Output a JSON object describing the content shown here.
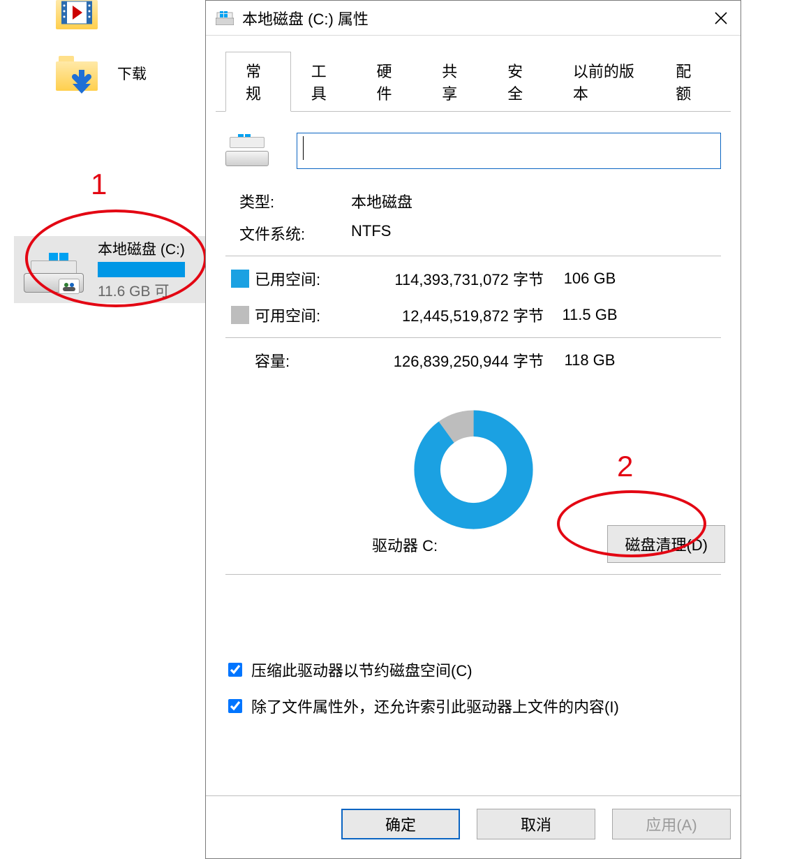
{
  "explorer": {
    "folder_downloads_label": "下载",
    "drive_c": {
      "title": "本地磁盘 (C:)",
      "subtitle": "11.6 GB 可"
    }
  },
  "window": {
    "title": "本地磁盘 (C:) 属性",
    "tabs": {
      "general": "常规",
      "tools": "工具",
      "hardware": "硬件",
      "sharing": "共享",
      "security": "安全",
      "previous": "以前的版本",
      "quota": "配额"
    },
    "name_value": "",
    "type_label": "类型:",
    "type_value": "本地磁盘",
    "fs_label": "文件系统:",
    "fs_value": "NTFS",
    "used_label": "已用空间:",
    "used_bytes": "114,393,731,072 字节",
    "used_human": "106 GB",
    "free_label": "可用空间:",
    "free_bytes": "12,445,519,872 字节",
    "free_human": "11.5 GB",
    "cap_label": "容量:",
    "cap_bytes": "126,839,250,944 字节",
    "cap_human": "118 GB",
    "drive_letter": "驱动器 C:",
    "cleanup_btn": "磁盘清理(D)",
    "check_compress": "压缩此驱动器以节约磁盘空间(C)",
    "check_index": "除了文件属性外，还允许索引此驱动器上文件的内容(I)",
    "ok": "确定",
    "cancel": "取消",
    "apply": "应用(A)"
  },
  "annotations": {
    "num1": "1",
    "num2": "2"
  },
  "chart_data": {
    "type": "pie",
    "title": "驱动器 C:",
    "categories": [
      "已用空间",
      "可用空间"
    ],
    "values": [
      106,
      11.5
    ],
    "unit": "GB",
    "colors": [
      "#1ba1e2",
      "#bdbdbd"
    ]
  }
}
